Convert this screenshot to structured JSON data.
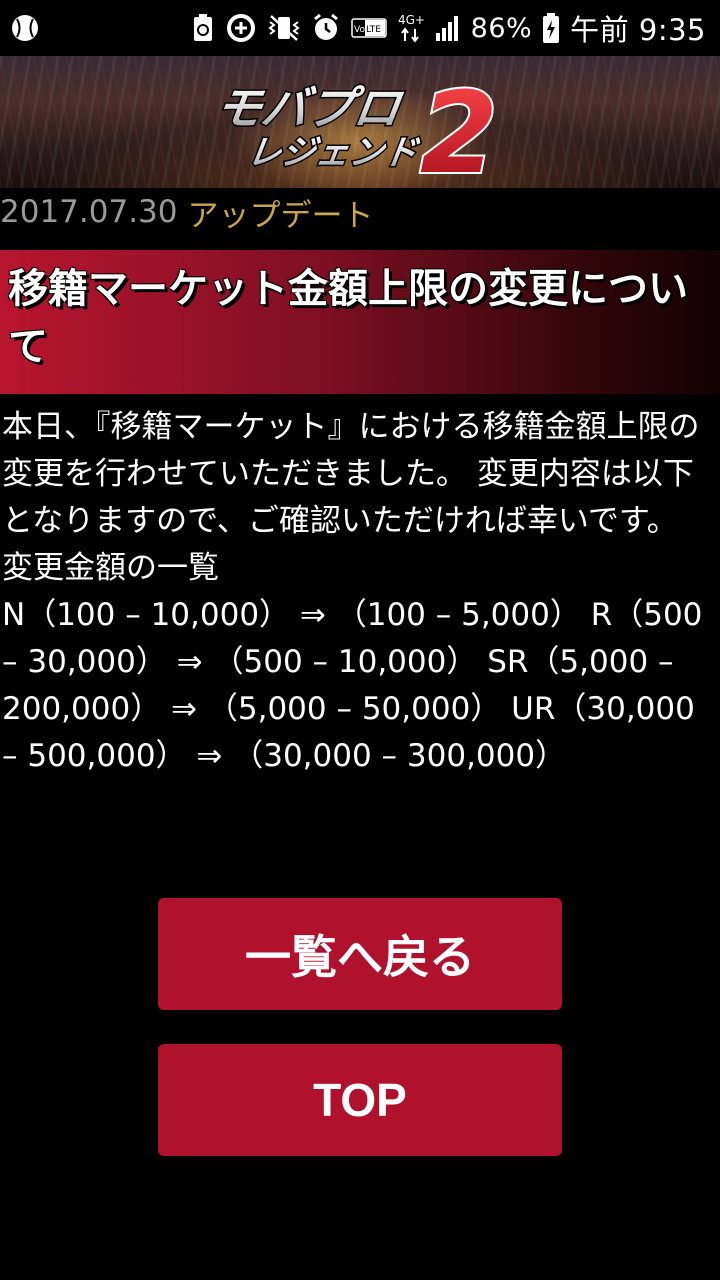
{
  "status_bar": {
    "battery_percent": "86%",
    "time": "午前 9:35",
    "network": "4G+",
    "volte": "VoLTE",
    "icons": [
      "baseball-icon",
      "recycle-icon",
      "data-saver-icon",
      "vibrate-icon",
      "alarm-icon",
      "volte-icon",
      "network-4g-icon",
      "signal-icon",
      "battery-icon"
    ]
  },
  "banner": {
    "logo_top": "モバプロ",
    "logo_bottom": "レジェンド",
    "logo_number": "2",
    "logo_colors": {
      "number": "#d9192e",
      "text": "#ffffff"
    }
  },
  "article": {
    "date": "2017.07.30",
    "category": "アップデート",
    "title": "移籍マーケット金額上限の変更について",
    "paragraph1": "本日、『移籍マーケット』における移籍金額上限の変更を行わせていただきました。 変更内容は以下となりますので、ご確認いただければ幸いです。",
    "list_heading": "変更金額の一覧",
    "changes": "N（100 – 10,000） ⇒ （100 – 5,000） R（500 – 30,000） ⇒ （500 – 10,000） SR（5,000 – 200,000） ⇒ （5,000 – 50,000） UR（30,000 – 500,000） ⇒ （30,000 – 300,000）"
  },
  "buttons": {
    "back_label": "一覧へ戻る",
    "top_label": "TOP"
  },
  "colors": {
    "accent": "#b0122e",
    "date": "#9a9a9a",
    "category": "#c8a64e"
  }
}
